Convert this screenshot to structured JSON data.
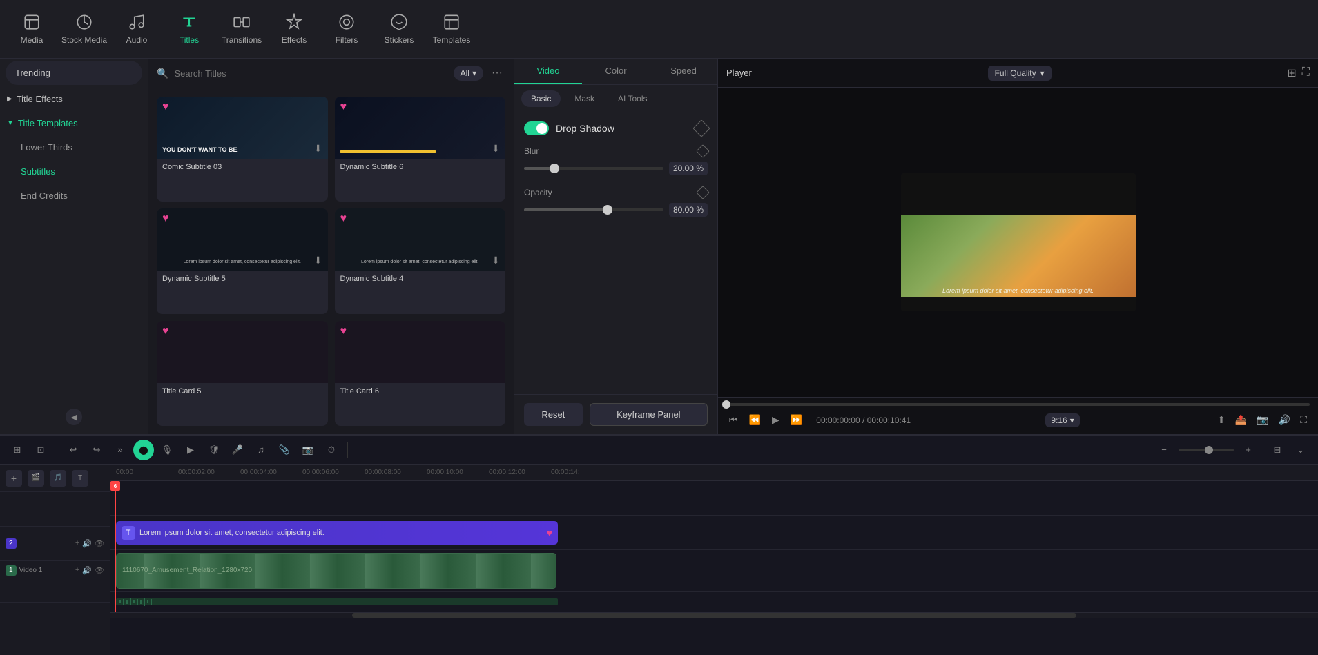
{
  "toolbar": {
    "items": [
      {
        "id": "media",
        "label": "Media",
        "icon": "media"
      },
      {
        "id": "stock_media",
        "label": "Stock Media",
        "icon": "stock"
      },
      {
        "id": "audio",
        "label": "Audio",
        "icon": "audio"
      },
      {
        "id": "titles",
        "label": "Titles",
        "icon": "titles",
        "active": true
      },
      {
        "id": "transitions",
        "label": "Transitions",
        "icon": "transitions"
      },
      {
        "id": "effects",
        "label": "Effects",
        "icon": "effects"
      },
      {
        "id": "filters",
        "label": "Filters",
        "icon": "filters"
      },
      {
        "id": "stickers",
        "label": "Stickers",
        "icon": "stickers"
      },
      {
        "id": "templates",
        "label": "Templates",
        "icon": "templates"
      }
    ]
  },
  "sidebar": {
    "trending_label": "Trending",
    "title_effects_label": "Title Effects",
    "title_templates_label": "Title Templates",
    "lower_thirds_label": "Lower Thirds",
    "subtitles_label": "Subtitles",
    "end_credits_label": "End Credits"
  },
  "search": {
    "placeholder": "Search Titles",
    "filter_label": "All"
  },
  "title_cards": [
    {
      "id": "comic_sub_03",
      "name": "Comic Subtitle 03",
      "style": "comic"
    },
    {
      "id": "dynamic_sub_6",
      "name": "Dynamic Subtitle 6",
      "style": "dynamic6"
    },
    {
      "id": "dynamic_sub_5",
      "name": "Dynamic Subtitle 5",
      "style": "dark"
    },
    {
      "id": "dynamic_sub_4",
      "name": "Dynamic Subtitle 4",
      "style": "dark2"
    },
    {
      "id": "card5",
      "name": "Title Card 5",
      "style": "pink"
    },
    {
      "id": "card6",
      "name": "Title Card 6",
      "style": "pink"
    }
  ],
  "properties": {
    "tabs": [
      "Video",
      "Color",
      "Speed"
    ],
    "active_tab": "Video",
    "subtabs": [
      "Basic",
      "Mask",
      "AI Tools"
    ],
    "active_subtab": "Basic",
    "drop_shadow": {
      "title": "Drop Shadow",
      "enabled": true,
      "blur": {
        "label": "Blur",
        "value": "20.00",
        "unit": "%",
        "fill_pct": 22
      },
      "opacity": {
        "label": "Opacity",
        "value": "80.00",
        "unit": "%",
        "fill_pct": 60
      }
    },
    "reset_label": "Reset",
    "keyframe_label": "Keyframe Panel"
  },
  "player": {
    "title": "Player",
    "quality": "Full Quality",
    "subtitle_text": "Lorem ipsum dolor sit amet, consectetur adipiscing elit.",
    "time_current": "00:00:00:00",
    "time_total": "00:00:10:41",
    "aspect_ratio": "9:16"
  },
  "timeline": {
    "ruler_marks": [
      "00:00",
      "00:00:02:00",
      "00:00:04:00",
      "00:00:06:00",
      "00:00:08:00",
      "00:00:10:00",
      "00:00:12:00",
      "00:00:14:"
    ],
    "tracks": [
      {
        "id": "empty_track",
        "type": "empty"
      },
      {
        "id": "subtitle_track",
        "type": "subtitle",
        "label": "2",
        "clip_text": "Lorem ipsum dolor sit amet, consectetur adipiscing elit.",
        "icon": "T"
      },
      {
        "id": "video_track",
        "type": "video",
        "label": "Video 1",
        "label_num": "1",
        "clip_text": "1110670_Amusement_Relation_1280x720"
      }
    ]
  }
}
